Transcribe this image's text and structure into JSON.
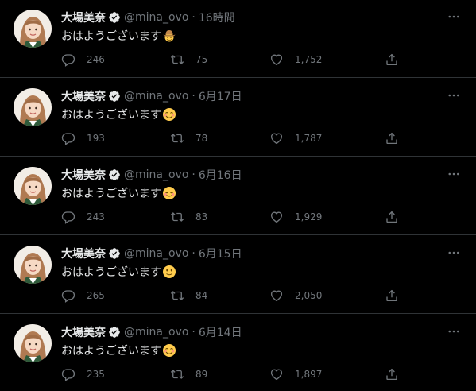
{
  "colors": {
    "background": "#000000",
    "text": "#e7e9ea",
    "muted": "#71767b",
    "divider": "#2f3336",
    "verified_badge": "#e7e9ea"
  },
  "tweets": [
    {
      "name": "大場美奈",
      "handle": "@mina_ovo",
      "separator": "·",
      "time": "16時間",
      "text": "おはようございます",
      "emoji": "cowboy-hat-face",
      "replies": "246",
      "retweets": "75",
      "likes": "1,752"
    },
    {
      "name": "大場美奈",
      "handle": "@mina_ovo",
      "separator": "·",
      "time": "6月17日",
      "text": "おはようございます",
      "emoji": "smiling-face-with-smiling-eyes",
      "replies": "193",
      "retweets": "78",
      "likes": "1,787"
    },
    {
      "name": "大場美奈",
      "handle": "@mina_ovo",
      "separator": "·",
      "time": "6月16日",
      "text": "おはようございます",
      "emoji": "smiling-face",
      "replies": "243",
      "retweets": "83",
      "likes": "1,929"
    },
    {
      "name": "大場美奈",
      "handle": "@mina_ovo",
      "separator": "·",
      "time": "6月15日",
      "text": "おはようございます",
      "emoji": "slightly-smiling-face",
      "replies": "265",
      "retweets": "84",
      "likes": "2,050"
    },
    {
      "name": "大場美奈",
      "handle": "@mina_ovo",
      "separator": "·",
      "time": "6月14日",
      "text": "おはようございます",
      "emoji": "smiling-face-with-smiling-eyes",
      "replies": "235",
      "retweets": "89",
      "likes": "1,897"
    }
  ]
}
